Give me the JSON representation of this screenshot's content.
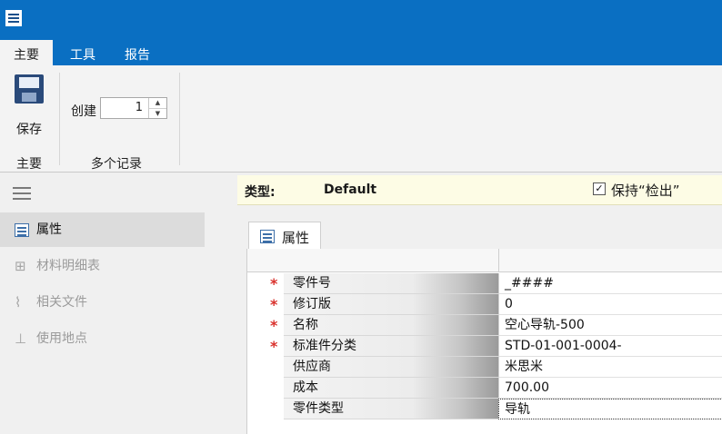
{
  "ribbon": {
    "tabs": [
      {
        "label": "主要",
        "active": true
      },
      {
        "label": "工具",
        "active": false
      },
      {
        "label": "报告",
        "active": false
      }
    ],
    "save_label": "保存",
    "group_main_label": "主要",
    "create_label": "创建",
    "create_count": "1",
    "group_multi_label": "多个记录"
  },
  "sidebar": {
    "items": [
      {
        "label": "属性",
        "icon": "properties-grid-icon",
        "active": true
      },
      {
        "label": "材料明细表",
        "icon": "tree-icon",
        "active": false
      },
      {
        "label": "相关文件",
        "icon": "paperclip-icon",
        "active": false
      },
      {
        "label": "使用地点",
        "icon": "hierarchy-icon",
        "active": false
      }
    ]
  },
  "infobar": {
    "type_label": "类型:",
    "type_value": "Default",
    "keep_checkout_label": "保持“检出”",
    "keep_checkout_checked": true
  },
  "properties_tab": {
    "label": "属性"
  },
  "properties": [
    {
      "name": "零件号",
      "value": "_####",
      "required": true
    },
    {
      "name": "修订版",
      "value": "0",
      "required": true
    },
    {
      "name": "名称",
      "value": "空心导轨-500",
      "required": true
    },
    {
      "name": "标准件分类",
      "value": "STD-01-001-0004-",
      "required": true
    },
    {
      "name": "供应商",
      "value": "米思米",
      "required": false
    },
    {
      "name": "成本",
      "value": "700.00",
      "required": false
    },
    {
      "name": "零件类型",
      "value": "导轨",
      "required": false,
      "focused": true
    }
  ],
  "colors": {
    "titlebar": "#0a6fc2",
    "required_star": "#d9302b",
    "infobar": "#fdfce5"
  }
}
